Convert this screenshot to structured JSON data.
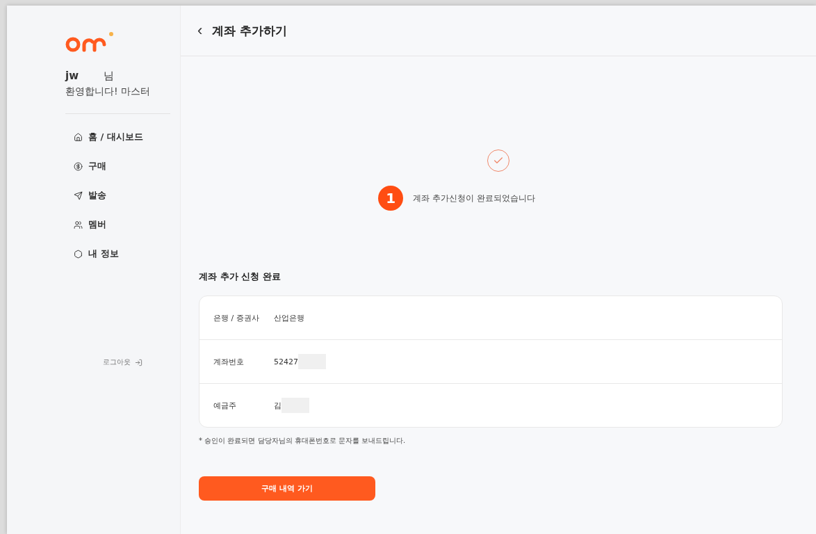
{
  "sidebar": {
    "user": {
      "name": "jw",
      "suffix": "님",
      "greeting": "환영합니다! 마스터"
    },
    "nav": [
      {
        "label": "홈 / 대시보드"
      },
      {
        "label": "구매"
      },
      {
        "label": "발송"
      },
      {
        "label": "멤버"
      },
      {
        "label": "내 정보"
      }
    ],
    "logout": "로그아웃"
  },
  "header": {
    "back": "‹",
    "title": "계좌 추가하기"
  },
  "status": {
    "badge": "1",
    "message": "계좌 추가신청이 완료되었습니다"
  },
  "section_title": "계좌 추가 신청 완료",
  "details": [
    {
      "label": "은행 / 증권사",
      "value": "산업은행",
      "redacted": false
    },
    {
      "label": "계좌번호",
      "value": "52427",
      "redacted": true
    },
    {
      "label": "예금주",
      "value": "김",
      "redacted": true
    }
  ],
  "note": "* 승인이 완료되면 담당자님의 휴대폰번호로 문자를 보내드립니다.",
  "button": "구매 내역 가기"
}
